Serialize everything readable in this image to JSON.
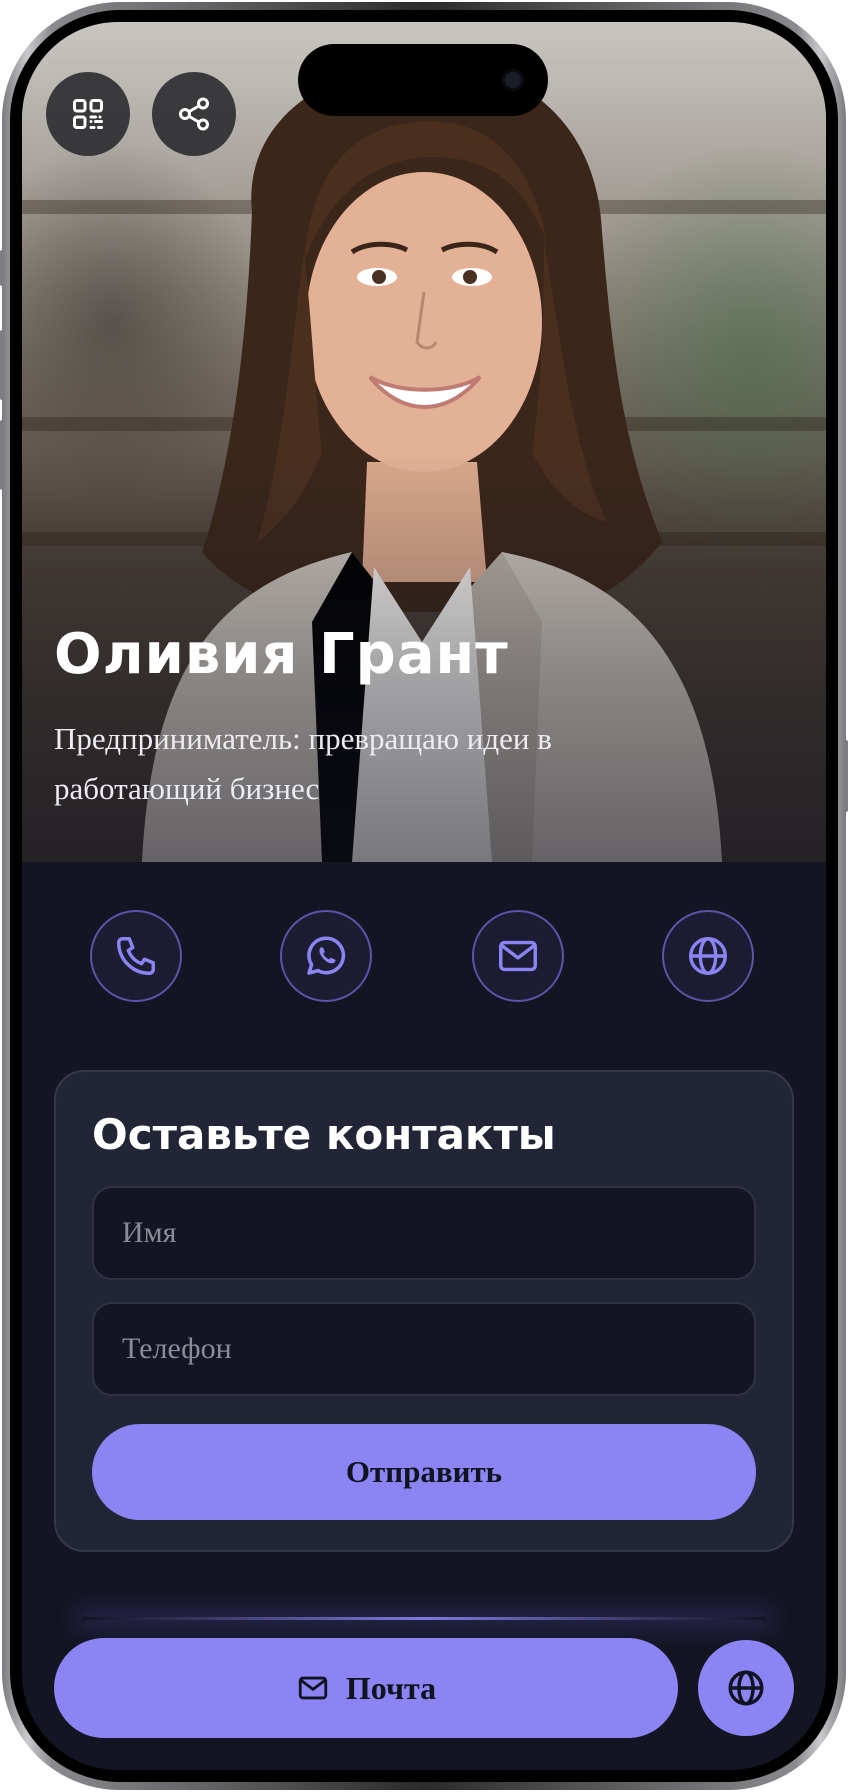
{
  "profile": {
    "name": "Оливия Грант",
    "tagline": "Предприниматель: превращаю идеи в работающий бизнес"
  },
  "top_actions": {
    "icons": [
      "qr-code-icon",
      "share-icon"
    ]
  },
  "contact_icons": [
    "phone-icon",
    "whatsapp-icon",
    "mail-icon",
    "globe-icon"
  ],
  "form": {
    "title": "Оставьте контакты",
    "name_placeholder": "Имя",
    "phone_placeholder": "Телефон",
    "submit_label": "Отправить"
  },
  "bottom_bar": {
    "mail_label": "Почта",
    "web_icon": "globe-icon"
  },
  "colors": {
    "accent": "#8b84f2",
    "background": "#131522",
    "card": "#222535",
    "icon_border": "#5a55a8"
  }
}
